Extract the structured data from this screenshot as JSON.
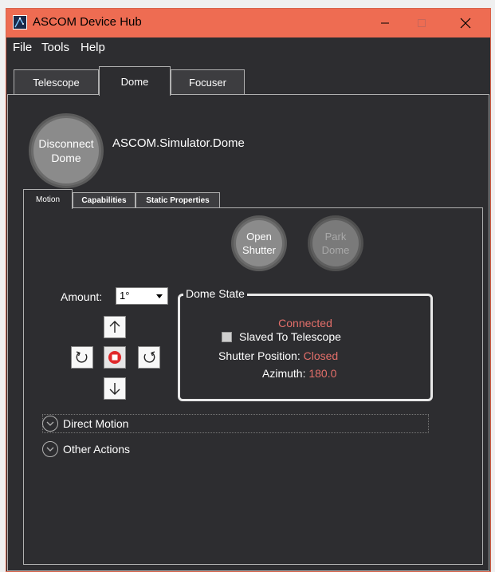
{
  "window": {
    "title": "ASCOM Device Hub",
    "controls": {
      "minimize": "—",
      "maximize": "☐",
      "close": "✕"
    }
  },
  "menu": [
    "File",
    "Tools",
    "Help"
  ],
  "device_tabs": [
    {
      "label": "Telescope",
      "active": false
    },
    {
      "label": "Dome",
      "active": true
    },
    {
      "label": "Focuser",
      "active": false
    }
  ],
  "connect": {
    "button_line1": "Disconnect",
    "button_line2": "Dome",
    "device_name": "ASCOM.Simulator.Dome"
  },
  "sub_tabs": [
    {
      "label": "Motion",
      "active": true
    },
    {
      "label": "Capabilities",
      "active": false
    },
    {
      "label": "Static Properties",
      "active": false
    }
  ],
  "shutter": {
    "open_line1": "Open",
    "open_line2": "Shutter",
    "park_line1": "Park",
    "park_line2": "Dome",
    "park_enabled": false
  },
  "amount": {
    "label": "Amount:",
    "value": "1°"
  },
  "dome_state": {
    "title": "Dome State",
    "status": "Connected",
    "slaved_label": "Slaved To Telescope",
    "slaved_checked": false,
    "shutter_label": "Shutter Position:",
    "shutter_value": "Closed",
    "azimuth_label": "Azimuth:",
    "azimuth_value": "180.0"
  },
  "expanders": [
    {
      "label": "Direct Motion"
    },
    {
      "label": "Other Actions"
    }
  ],
  "colors": {
    "titlebar": "#ee6c52",
    "background": "#2d2d30",
    "accent_value": "#e46f6a",
    "stop_button": "#e0282a"
  }
}
